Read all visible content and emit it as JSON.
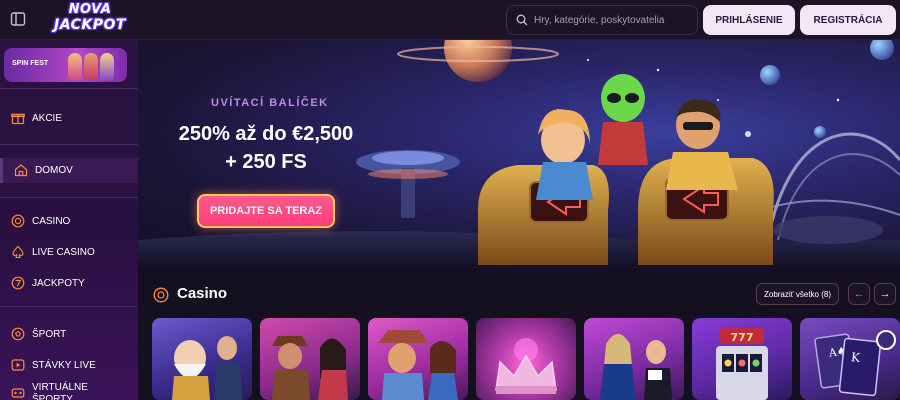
{
  "header": {
    "logo": {
      "line1": "NOVA",
      "line2": "JACKPOT"
    },
    "search": {
      "placeholder": "Hry, kategórie, poskytovatelia"
    },
    "login_label": "PRIHLÁSENIE",
    "register_label": "REGISTRÁCIA"
  },
  "sidebar": {
    "promo": {
      "label": "SPIN FEST"
    },
    "items": [
      {
        "label": "AKCIE",
        "icon": "gift-icon"
      },
      {
        "label": "DOMOV",
        "icon": "home-icon",
        "active": true
      },
      {
        "label": "CASINO",
        "icon": "chip-icon"
      },
      {
        "label": "LIVE CASINO",
        "icon": "spade-icon"
      },
      {
        "label": "JACKPOTY",
        "icon": "seven-icon"
      },
      {
        "label": "ŠPORT",
        "icon": "ball-icon"
      },
      {
        "label": "STÁVKY LIVE",
        "icon": "play-icon"
      },
      {
        "label": "VIRTUÁLNE ŠPORTY",
        "icon": "virtual-icon"
      }
    ]
  },
  "hero": {
    "subtitle": "UVÍTACÍ BALÍČEK",
    "title_line1": "250% až do €2,500",
    "title_line2": "+ 250 FS",
    "cta_label": "PRIDAJTE SA TERAZ"
  },
  "casino_section": {
    "title": "Casino",
    "view_all_label": "Zobraziť všetko (8)",
    "prev_label": "←",
    "next_label": "→",
    "cards": [
      {
        "name": "zeus-game"
      },
      {
        "name": "adventurer-game"
      },
      {
        "name": "cowboy-game"
      },
      {
        "name": "crown-game"
      },
      {
        "name": "live-dealer-game"
      },
      {
        "name": "slot-777-game"
      },
      {
        "name": "cards-game"
      }
    ]
  },
  "colors": {
    "accent_pink": "#ff3d7a",
    "button_light": "#f3e6f5",
    "sidebar_bg": "#2a1340"
  }
}
